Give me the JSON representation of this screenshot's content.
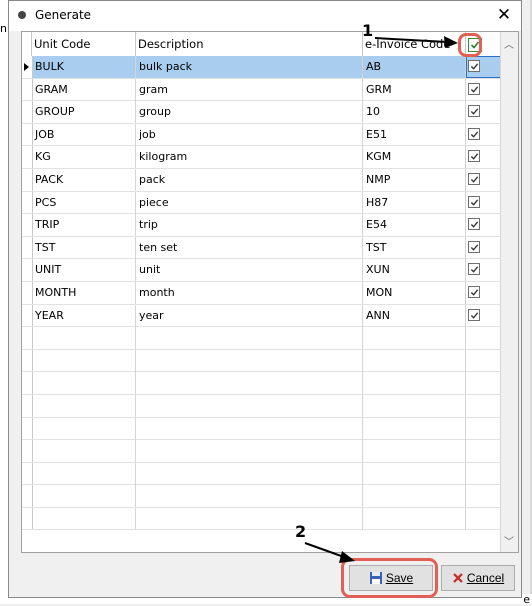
{
  "window": {
    "title": "Generate"
  },
  "background": {
    "left_fragment": "n",
    "bottom_fragment": "e"
  },
  "grid": {
    "columns": [
      "Unit Code",
      "Description",
      "e-Invoice Code"
    ],
    "header_checkbox_checked": true,
    "rows": [
      {
        "code": "BULK",
        "description": "bulk pack",
        "einvoice": "AB",
        "checked": true,
        "selected": true
      },
      {
        "code": "GRAM",
        "description": "gram",
        "einvoice": "GRM",
        "checked": true
      },
      {
        "code": "GROUP",
        "description": "group",
        "einvoice": "10",
        "checked": true
      },
      {
        "code": "JOB",
        "description": "job",
        "einvoice": "E51",
        "checked": true
      },
      {
        "code": "KG",
        "description": "kilogram",
        "einvoice": "KGM",
        "checked": true
      },
      {
        "code": "PACK",
        "description": "pack",
        "einvoice": "NMP",
        "checked": true
      },
      {
        "code": "PCS",
        "description": "piece",
        "einvoice": "H87",
        "checked": true
      },
      {
        "code": "TRIP",
        "description": "trip",
        "einvoice": "E54",
        "checked": true
      },
      {
        "code": "TST",
        "description": "ten set",
        "einvoice": "TST",
        "checked": true
      },
      {
        "code": "UNIT",
        "description": "unit",
        "einvoice": "XUN",
        "checked": true
      },
      {
        "code": "MONTH",
        "description": "month",
        "einvoice": "MON",
        "checked": true
      },
      {
        "code": "YEAR",
        "description": "year",
        "einvoice": "ANN",
        "checked": true
      }
    ],
    "empty_rows": 9
  },
  "buttons": {
    "save_label": "Save",
    "cancel_label": "Cancel"
  },
  "annotations": {
    "label1": "1",
    "label2": "2",
    "highlight_color": "#e06055"
  }
}
